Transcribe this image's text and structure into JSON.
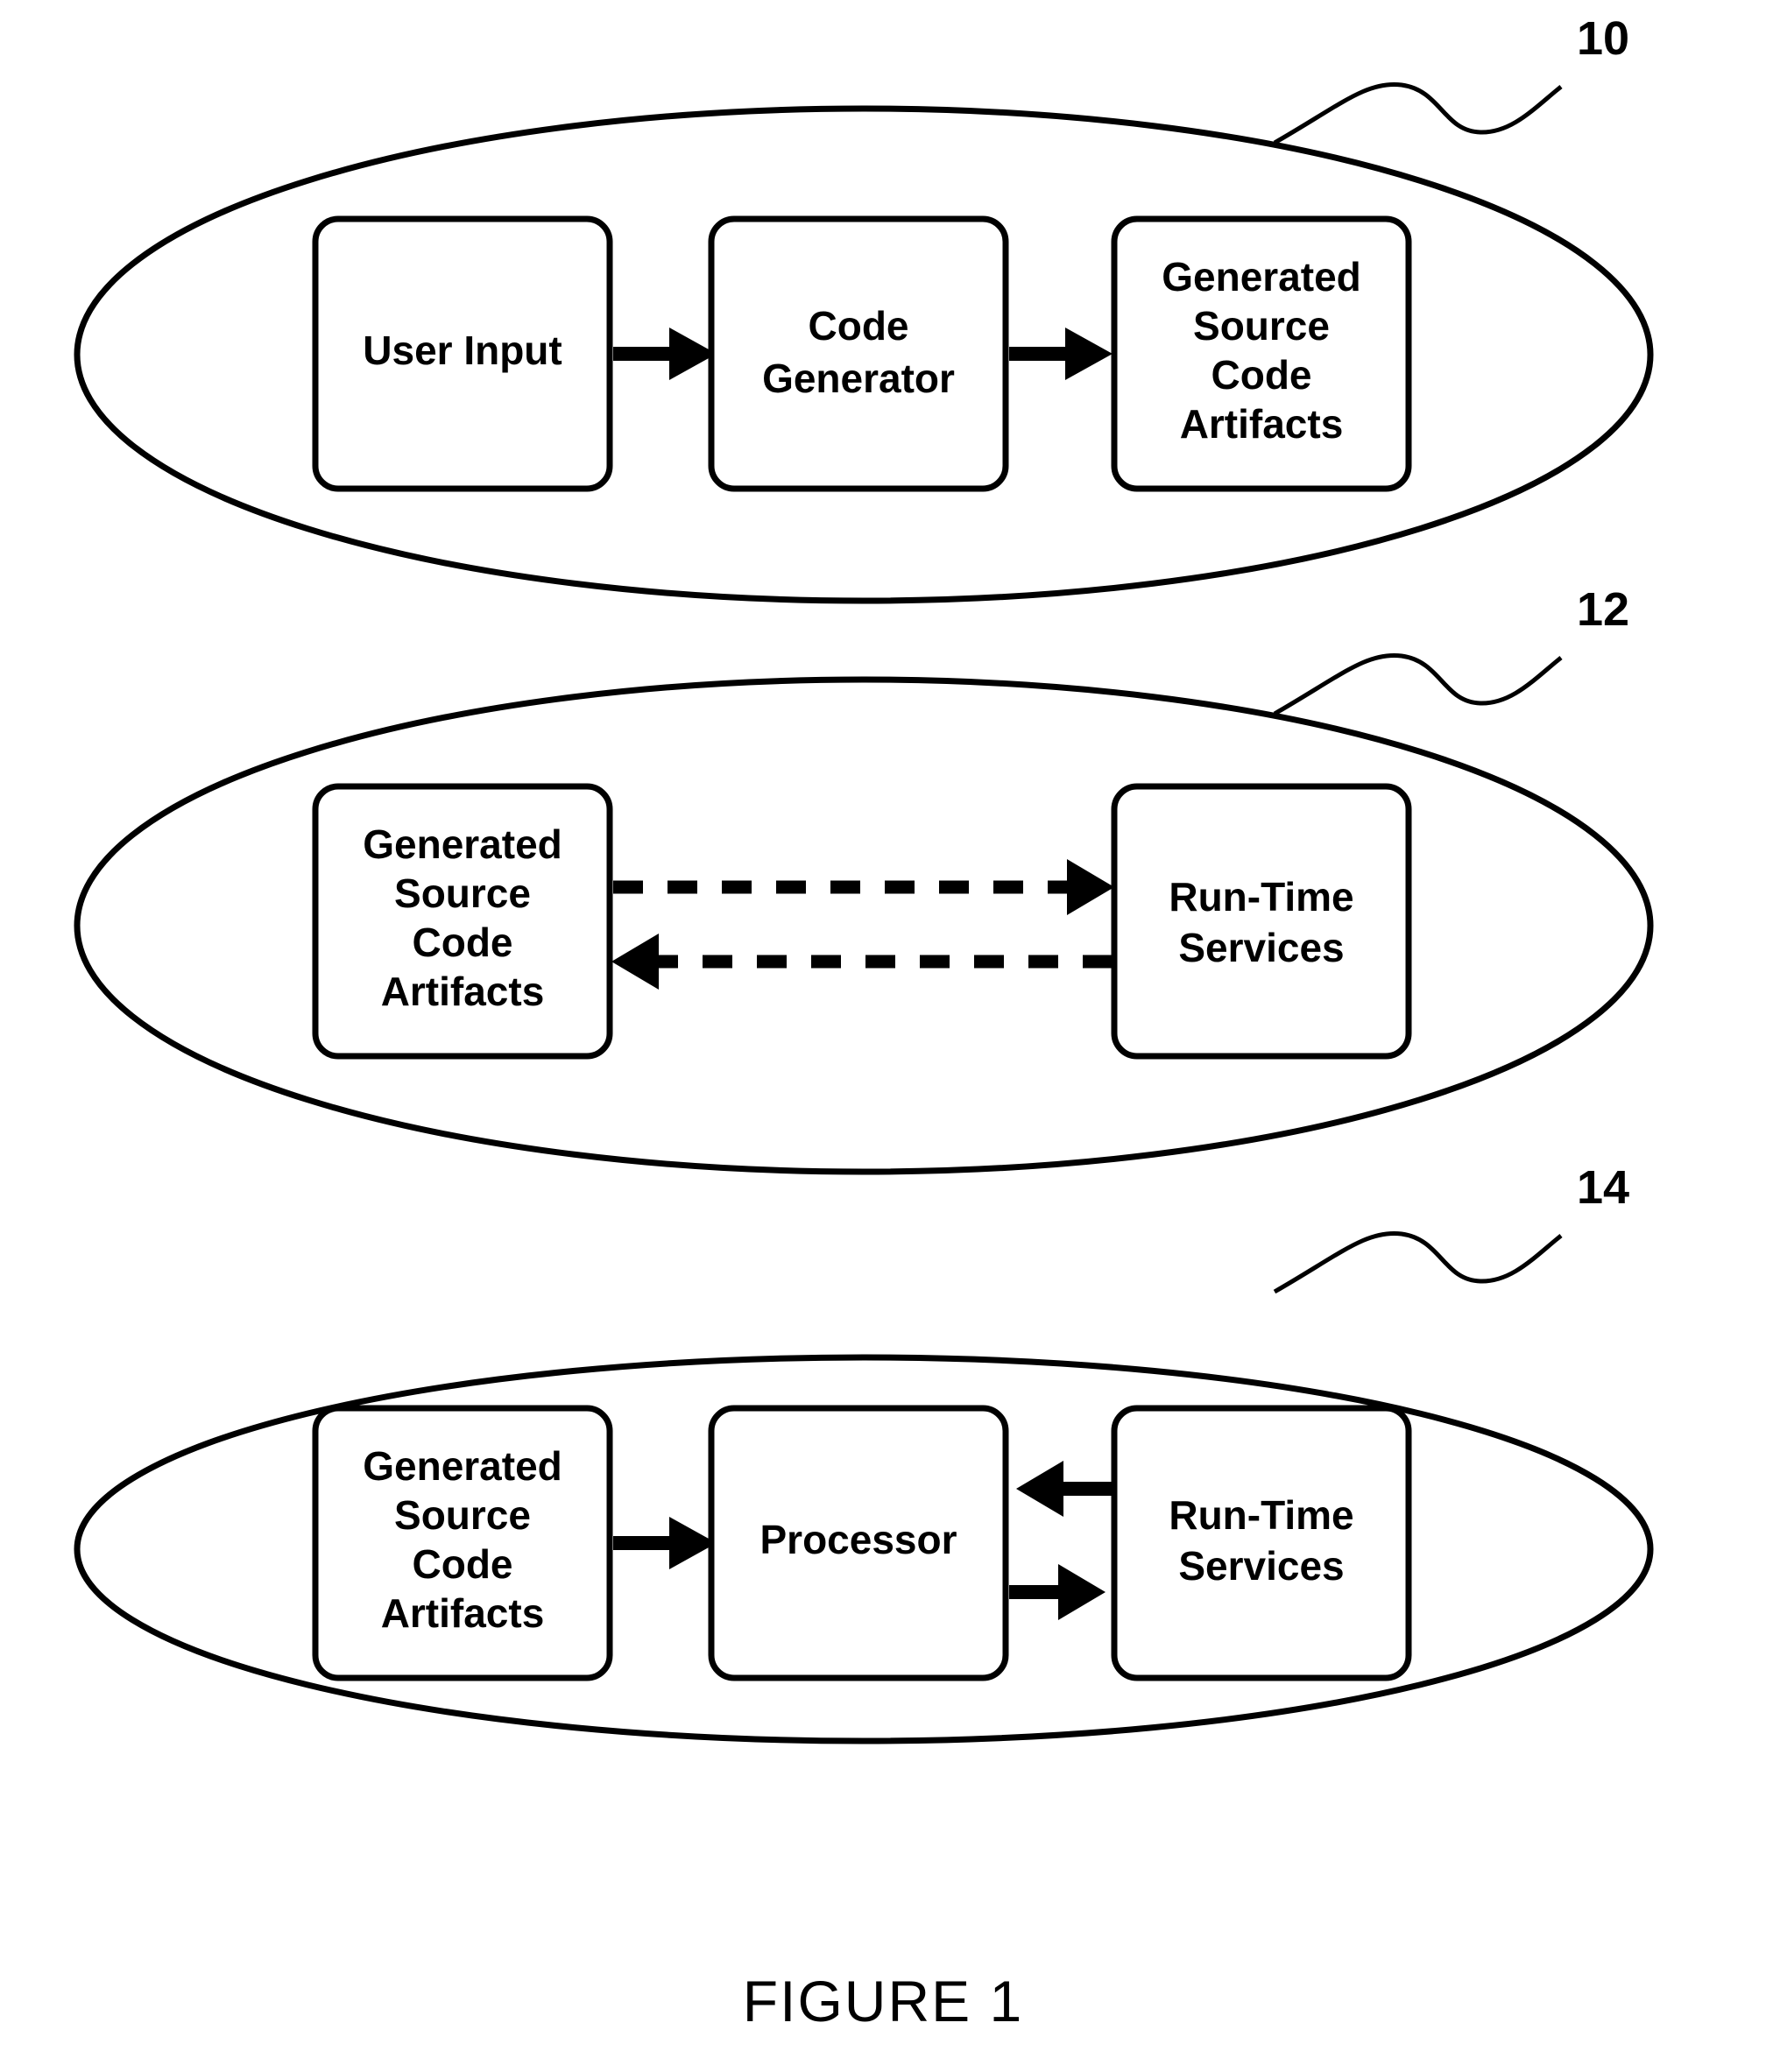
{
  "figure": {
    "caption": "FIGURE 1",
    "stages": [
      {
        "ref": "10",
        "name": "code-generation-stage",
        "nodes": [
          {
            "id": "user-input",
            "lines": [
              "User Input"
            ]
          },
          {
            "id": "code-generator",
            "lines": [
              "Code",
              "Generator"
            ]
          },
          {
            "id": "generated-source-code-artifacts",
            "lines": [
              "Generated",
              "Source",
              "Code",
              "Artifacts"
            ]
          }
        ],
        "connectors": [
          {
            "id": "user-input-to-code-generator",
            "style": "solid",
            "direction": "right"
          },
          {
            "id": "code-generator-to-artifacts",
            "style": "solid",
            "direction": "right"
          }
        ]
      },
      {
        "ref": "12",
        "name": "compile-bind-stage",
        "nodes": [
          {
            "id": "generated-source-code-artifacts",
            "lines": [
              "Generated",
              "Source",
              "Code",
              "Artifacts"
            ]
          },
          {
            "id": "run-time-services",
            "lines": [
              "Run-Time",
              "Services"
            ]
          }
        ],
        "connectors": [
          {
            "id": "artifacts-to-run-time-services",
            "style": "dashed",
            "direction": "right"
          },
          {
            "id": "run-time-services-to-artifacts",
            "style": "dashed",
            "direction": "left"
          }
        ]
      },
      {
        "ref": "14",
        "name": "execution-stage",
        "nodes": [
          {
            "id": "generated-source-code-artifacts",
            "lines": [
              "Generated",
              "Source",
              "Code",
              "Artifacts"
            ]
          },
          {
            "id": "processor",
            "lines": [
              "Processor"
            ]
          },
          {
            "id": "run-time-services",
            "lines": [
              "Run-Time",
              "Services"
            ]
          }
        ],
        "connectors": [
          {
            "id": "artifacts-to-processor",
            "style": "solid",
            "direction": "right"
          },
          {
            "id": "run-time-services-to-processor",
            "style": "solid",
            "direction": "left"
          },
          {
            "id": "processor-to-run-time-services",
            "style": "solid",
            "direction": "right"
          }
        ]
      }
    ]
  },
  "colors": {
    "ink": "#000000",
    "paper": "#ffffff"
  }
}
